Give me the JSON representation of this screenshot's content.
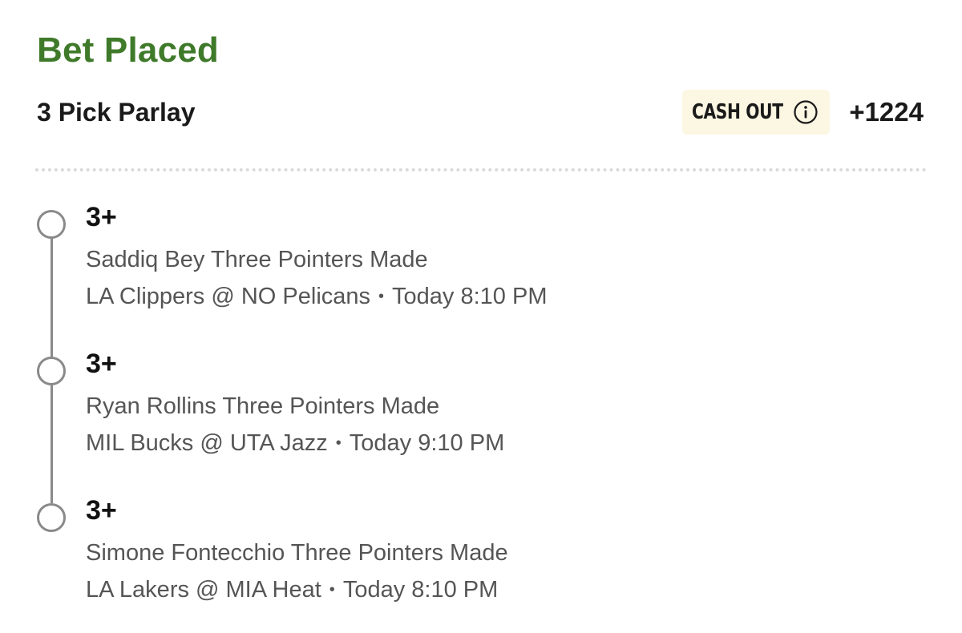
{
  "bet": {
    "status": "Bet Placed",
    "type": "3 Pick Parlay",
    "cash_out_label": "CASH OUT",
    "odds": "+1224"
  },
  "icons": {
    "info": "info-circle-icon",
    "leg_marker": "hollow-circle-icon"
  },
  "colors": {
    "status_green": "#3f7a2a",
    "cash_out_bg": "#fcf7e3",
    "timeline_gray": "#8a8a8a",
    "secondary_text": "#555555"
  },
  "legs": [
    {
      "line": "3+",
      "market": "Saddiq Bey Three Pointers Made",
      "matchup": "LA Clippers @ NO Pelicans",
      "separator": "•",
      "time": "Today 8:10 PM"
    },
    {
      "line": "3+",
      "market": "Ryan Rollins Three Pointers Made",
      "matchup": "MIL Bucks @ UTA Jazz",
      "separator": "•",
      "time": "Today 9:10 PM"
    },
    {
      "line": "3+",
      "market": "Simone Fontecchio Three Pointers Made",
      "matchup": "LA Lakers @ MIA Heat",
      "separator": "•",
      "time": "Today 8:10 PM"
    }
  ]
}
